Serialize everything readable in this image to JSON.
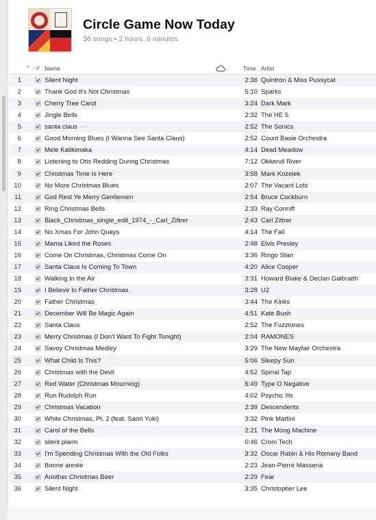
{
  "playlist": {
    "title": "Circle Game Now Today",
    "song_count": "36 songs",
    "separator": "•",
    "duration": "2 hours, 6 minutes"
  },
  "columns": {
    "sort_indicator": "^",
    "check": "✓",
    "name": "Name",
    "cloud_icon": "cloud-icon",
    "time": "Time",
    "artist": "Artist"
  },
  "tracks": [
    {
      "num": "1",
      "name": "Silent Night",
      "time": "2:36",
      "artist": "Quintron & Miss Pussycat"
    },
    {
      "num": "2",
      "name": "Thank God It's Not Christmas",
      "time": "5:10",
      "artist": "Sparks"
    },
    {
      "num": "3",
      "name": "Cherry Tree Carol",
      "time": "3:24",
      "artist": "Dark Mark"
    },
    {
      "num": "4",
      "name": "Jingle Bells",
      "time": "2:32",
      "artist": "The HE 5"
    },
    {
      "num": "5",
      "name": "santa claus",
      "time": "2:52",
      "artist": "The Sonics",
      "more": "···"
    },
    {
      "num": "6",
      "name": "Good Morning Blues (I Wanna See Santa Claus)",
      "time": "2:52",
      "artist": "Count Basie Orchestra"
    },
    {
      "num": "7",
      "name": "Mele Kalikimaka",
      "time": "4:14",
      "artist": "Dead Meadow"
    },
    {
      "num": "8",
      "name": "Listening to Otis Redding During Christmas",
      "time": "7:12",
      "artist": "Okkervil River"
    },
    {
      "num": "9",
      "name": "Christmas Time Is Here",
      "time": "3:58",
      "artist": "Mark Kozelek"
    },
    {
      "num": "10",
      "name": "No More Christmas Blues",
      "time": "2:07",
      "artist": "The Vacant Lots"
    },
    {
      "num": "11",
      "name": "God Rest Ye Merry Gentlemen",
      "time": "2:54",
      "artist": "Bruce Cockburn"
    },
    {
      "num": "12",
      "name": "Ring Christmas Bells",
      "time": "2:33",
      "artist": "Ray Conniff"
    },
    {
      "num": "13",
      "name": "Black_Christmas_single_edit_1974_-_Carl_Zittrer",
      "time": "2:43",
      "artist": "Carl Zittrer"
    },
    {
      "num": "14",
      "name": "No Xmas For John Quays",
      "time": "4:14",
      "artist": "The Fall"
    },
    {
      "num": "15",
      "name": "Mama Liked the Roses",
      "time": "2:48",
      "artist": "Elvis Presley"
    },
    {
      "num": "16",
      "name": "Come On Christmas, Christmas Come On",
      "time": "3:36",
      "artist": "Ringo Starr"
    },
    {
      "num": "17",
      "name": "Santa Claus Is Coming To Town",
      "time": "4:20",
      "artist": "Alice Cooper"
    },
    {
      "num": "18",
      "name": "Walking In the Air",
      "time": "3:31",
      "artist": "Howard Blake & Declan Galbraith"
    },
    {
      "num": "19",
      "name": "I Believe In Father Christmas",
      "time": "3:28",
      "artist": "U2"
    },
    {
      "num": "20",
      "name": "Father Christmas",
      "time": "3:44",
      "artist": "The Kinks"
    },
    {
      "num": "21",
      "name": "December Will Be Magic Again",
      "time": "4:51",
      "artist": "Kate Bush"
    },
    {
      "num": "22",
      "name": "Santa Claus",
      "time": "2:52",
      "artist": "The Fuzztones"
    },
    {
      "num": "23",
      "name": " Merry Christmas (I Don't Want To Fight Tonight)",
      "time": "2:04",
      "artist": "RAMONES"
    },
    {
      "num": "24",
      "name": "Savoy Christmas Medley",
      "time": "3:29",
      "artist": "The New Mayfair Orchestra"
    },
    {
      "num": "25",
      "name": "What Child Is This?",
      "time": "5:06",
      "artist": "Sleepy Sun"
    },
    {
      "num": "26",
      "name": "Christmas with the Devil",
      "time": "4:52",
      "artist": "Spinal Tap"
    },
    {
      "num": "27",
      "name": "Red Water (Christmas Mourning)",
      "time": "6:49",
      "artist": "Type O Negative"
    },
    {
      "num": "28",
      "name": "Run Rudolph Run",
      "time": "4:02",
      "artist": "Psychic Ills"
    },
    {
      "num": "29",
      "name": "Christmas Vacation",
      "time": "2:39",
      "artist": "Descendents"
    },
    {
      "num": "30",
      "name": "White Christmas, Pt. 2 (feat. Saori Yuki)",
      "time": "3:32",
      "artist": "Pink Martini"
    },
    {
      "num": "31",
      "name": "Carol of the Bells",
      "time": "2:21",
      "artist": "The Moog Machine"
    },
    {
      "num": "32",
      "name": "silent plarm",
      "time": "0:46",
      "artist": "Crom Tech"
    },
    {
      "num": "33",
      "name": "I'm Spending Christmas With the Old Folks",
      "time": "3:32",
      "artist": "Oscar Rabin & His Romany Band"
    },
    {
      "num": "34",
      "name": "Bonne année",
      "time": "2:23",
      "artist": "Jean-Pierre Masseria"
    },
    {
      "num": "35",
      "name": "Another Christmas Beer",
      "time": "2:29",
      "artist": "Fear"
    },
    {
      "num": "36",
      "name": "Silent Night",
      "time": "3:35",
      "artist": "Christopher Lee"
    }
  ]
}
